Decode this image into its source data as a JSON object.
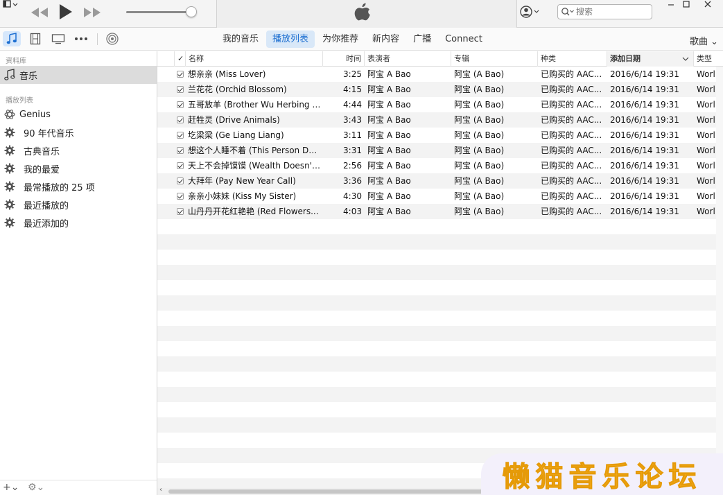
{
  "search": {
    "placeholder": "搜索"
  },
  "nav": {
    "tabs": [
      {
        "label": "我的音乐",
        "active": false
      },
      {
        "label": "播放列表",
        "active": true
      },
      {
        "label": "为你推荐",
        "active": false
      },
      {
        "label": "新内容",
        "active": false
      },
      {
        "label": "广播",
        "active": false
      },
      {
        "label": "Connect",
        "active": false
      }
    ],
    "view_switch": "歌曲 ⌄"
  },
  "sidebar": {
    "library_header": "资料库",
    "library_items": [
      {
        "label": "音乐",
        "icon": "music-note-icon",
        "selected": true
      }
    ],
    "playlists_header": "播放列表",
    "playlist_items": [
      {
        "label": "Genius",
        "icon": "genius-icon"
      },
      {
        "label": "90 年代音乐",
        "icon": "gear-icon"
      },
      {
        "label": "古典音乐",
        "icon": "gear-icon"
      },
      {
        "label": "我的最爱",
        "icon": "gear-icon"
      },
      {
        "label": "最常播放的 25 项",
        "icon": "gear-icon"
      },
      {
        "label": "最近播放的",
        "icon": "gear-icon"
      },
      {
        "label": "最近添加的",
        "icon": "gear-icon"
      }
    ],
    "footer": {
      "add_label": "+⌄",
      "settings_label": "⚙⌄"
    }
  },
  "table": {
    "columns": {
      "check": "✓",
      "name": "名称",
      "time": "时间",
      "artist": "表演者",
      "album": "专辑",
      "kind": "种类",
      "date_added": "添加日期",
      "type": "类型"
    },
    "rows": [
      {
        "name": "想亲亲 (Miss Lover)",
        "time": "3:25",
        "artist": "阿宝 A Bao",
        "album": "阿宝 (A Bao)",
        "kind": "已购买的 AAC...",
        "date": "2016/6/14 19:31",
        "type": "Worl"
      },
      {
        "name": "兰花花 (Orchid Blossom)",
        "time": "4:15",
        "artist": "阿宝 A Bao",
        "album": "阿宝 (A Bao)",
        "kind": "已购买的 AAC...",
        "date": "2016/6/14 19:31",
        "type": "Worl"
      },
      {
        "name": "五哥放羊 (Brother Wu Herbing t...",
        "time": "4:44",
        "artist": "阿宝 A Bao",
        "album": "阿宝 (A Bao)",
        "kind": "已购买的 AAC...",
        "date": "2016/6/14 19:31",
        "type": "Worl"
      },
      {
        "name": "赶牲灵 (Drive Animals)",
        "time": "3:43",
        "artist": "阿宝 A Bao",
        "album": "阿宝 (A Bao)",
        "kind": "已购买的 AAC...",
        "date": "2016/6/14 19:31",
        "type": "Worl"
      },
      {
        "name": "圪梁梁 (Ge Liang Liang)",
        "time": "3:11",
        "artist": "阿宝 A Bao",
        "album": "阿宝 (A Bao)",
        "kind": "已购买的 AAC...",
        "date": "2016/6/14 19:31",
        "type": "Worl"
      },
      {
        "name": "想这个人睡不着 (This Person Do...",
        "time": "3:31",
        "artist": "阿宝 A Bao",
        "album": "阿宝 (A Bao)",
        "kind": "已购买的 AAC...",
        "date": "2016/6/14 19:31",
        "type": "Worl"
      },
      {
        "name": "天上不会掉馍馍 (Wealth Doesn't...",
        "time": "2:56",
        "artist": "阿宝 A Bao",
        "album": "阿宝 (A Bao)",
        "kind": "已购买的 AAC...",
        "date": "2016/6/14 19:31",
        "type": "Worl"
      },
      {
        "name": "大拜年 (Pay New Year Call)",
        "time": "3:36",
        "artist": "阿宝 A Bao",
        "album": "阿宝 (A Bao)",
        "kind": "已购买的 AAC...",
        "date": "2016/6/14 19:31",
        "type": "Worl"
      },
      {
        "name": "亲亲小妹妹 (Kiss My Sister)",
        "time": "4:30",
        "artist": "阿宝 A Bao",
        "album": "阿宝 (A Bao)",
        "kind": "已购买的 AAC...",
        "date": "2016/6/14 19:31",
        "type": "Worl"
      },
      {
        "name": "山丹丹开花红艳艳 (Red Flowers...",
        "time": "4:03",
        "artist": "阿宝 A Bao",
        "album": "阿宝 (A Bao)",
        "kind": "已购买的 AAC...",
        "date": "2016/6/14 19:31",
        "type": "Worl"
      }
    ]
  },
  "watermark": {
    "text": "懒猫音乐论坛"
  },
  "colors": {
    "accent": "#1d6fd1",
    "tab_active_bg": "#d9e8f8",
    "watermark": "#f3a91a"
  }
}
